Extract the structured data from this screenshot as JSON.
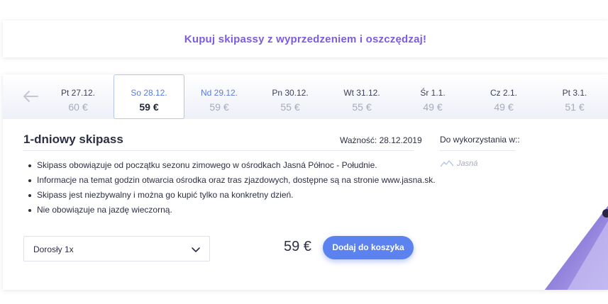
{
  "banner": {
    "text": "Kupuj skipassy z wyprzedzeniem i oszczędzaj!"
  },
  "dates": [
    {
      "day": "Pt 27.12.",
      "price": "60 €",
      "state": "normal"
    },
    {
      "day": "So 28.12.",
      "price": "59 €",
      "state": "active"
    },
    {
      "day": "Nd 29.12.",
      "price": "59 €",
      "state": "weekend"
    },
    {
      "day": "Pn 30.12.",
      "price": "55 €",
      "state": "normal"
    },
    {
      "day": "Wt 31.12.",
      "price": "55 €",
      "state": "normal"
    },
    {
      "day": "Śr 1.1.",
      "price": "49 €",
      "state": "normal"
    },
    {
      "day": "Cz 2.1.",
      "price": "49 €",
      "state": "normal"
    },
    {
      "day": "Pt 3.1.",
      "price": "51 €",
      "state": "normal"
    }
  ],
  "product": {
    "title": "1-dniowy skipass",
    "validity": "Ważność: 28.12.2019",
    "bullets": [
      "Skipass obowiązuje od początku sezonu zimowego w ośrodkach Jasná Północ - Południe.",
      "Informacje na temat godzin otwarcia ośrodka oraz tras zjazdowych, dostępne są na stronie www.jasna.sk.",
      "Skipass jest niezbywalny i można go kupić tylko na konkretny dzień.",
      "Nie obowiązuje na jazdę wieczorną."
    ],
    "select_value": "Dorosły 1x",
    "price": "59 €",
    "add_button": "Dodaj do koszyka"
  },
  "usage": {
    "title": "Do wykorzystania w::",
    "resort": "Jasná"
  },
  "colors": {
    "accent": "#5b82ee",
    "banner": "#7b5ce0",
    "muted": "#a7abba"
  },
  "icons": {
    "back": "arrow-left-icon",
    "select": "chevron-down-icon",
    "resort": "mountain-icon"
  }
}
